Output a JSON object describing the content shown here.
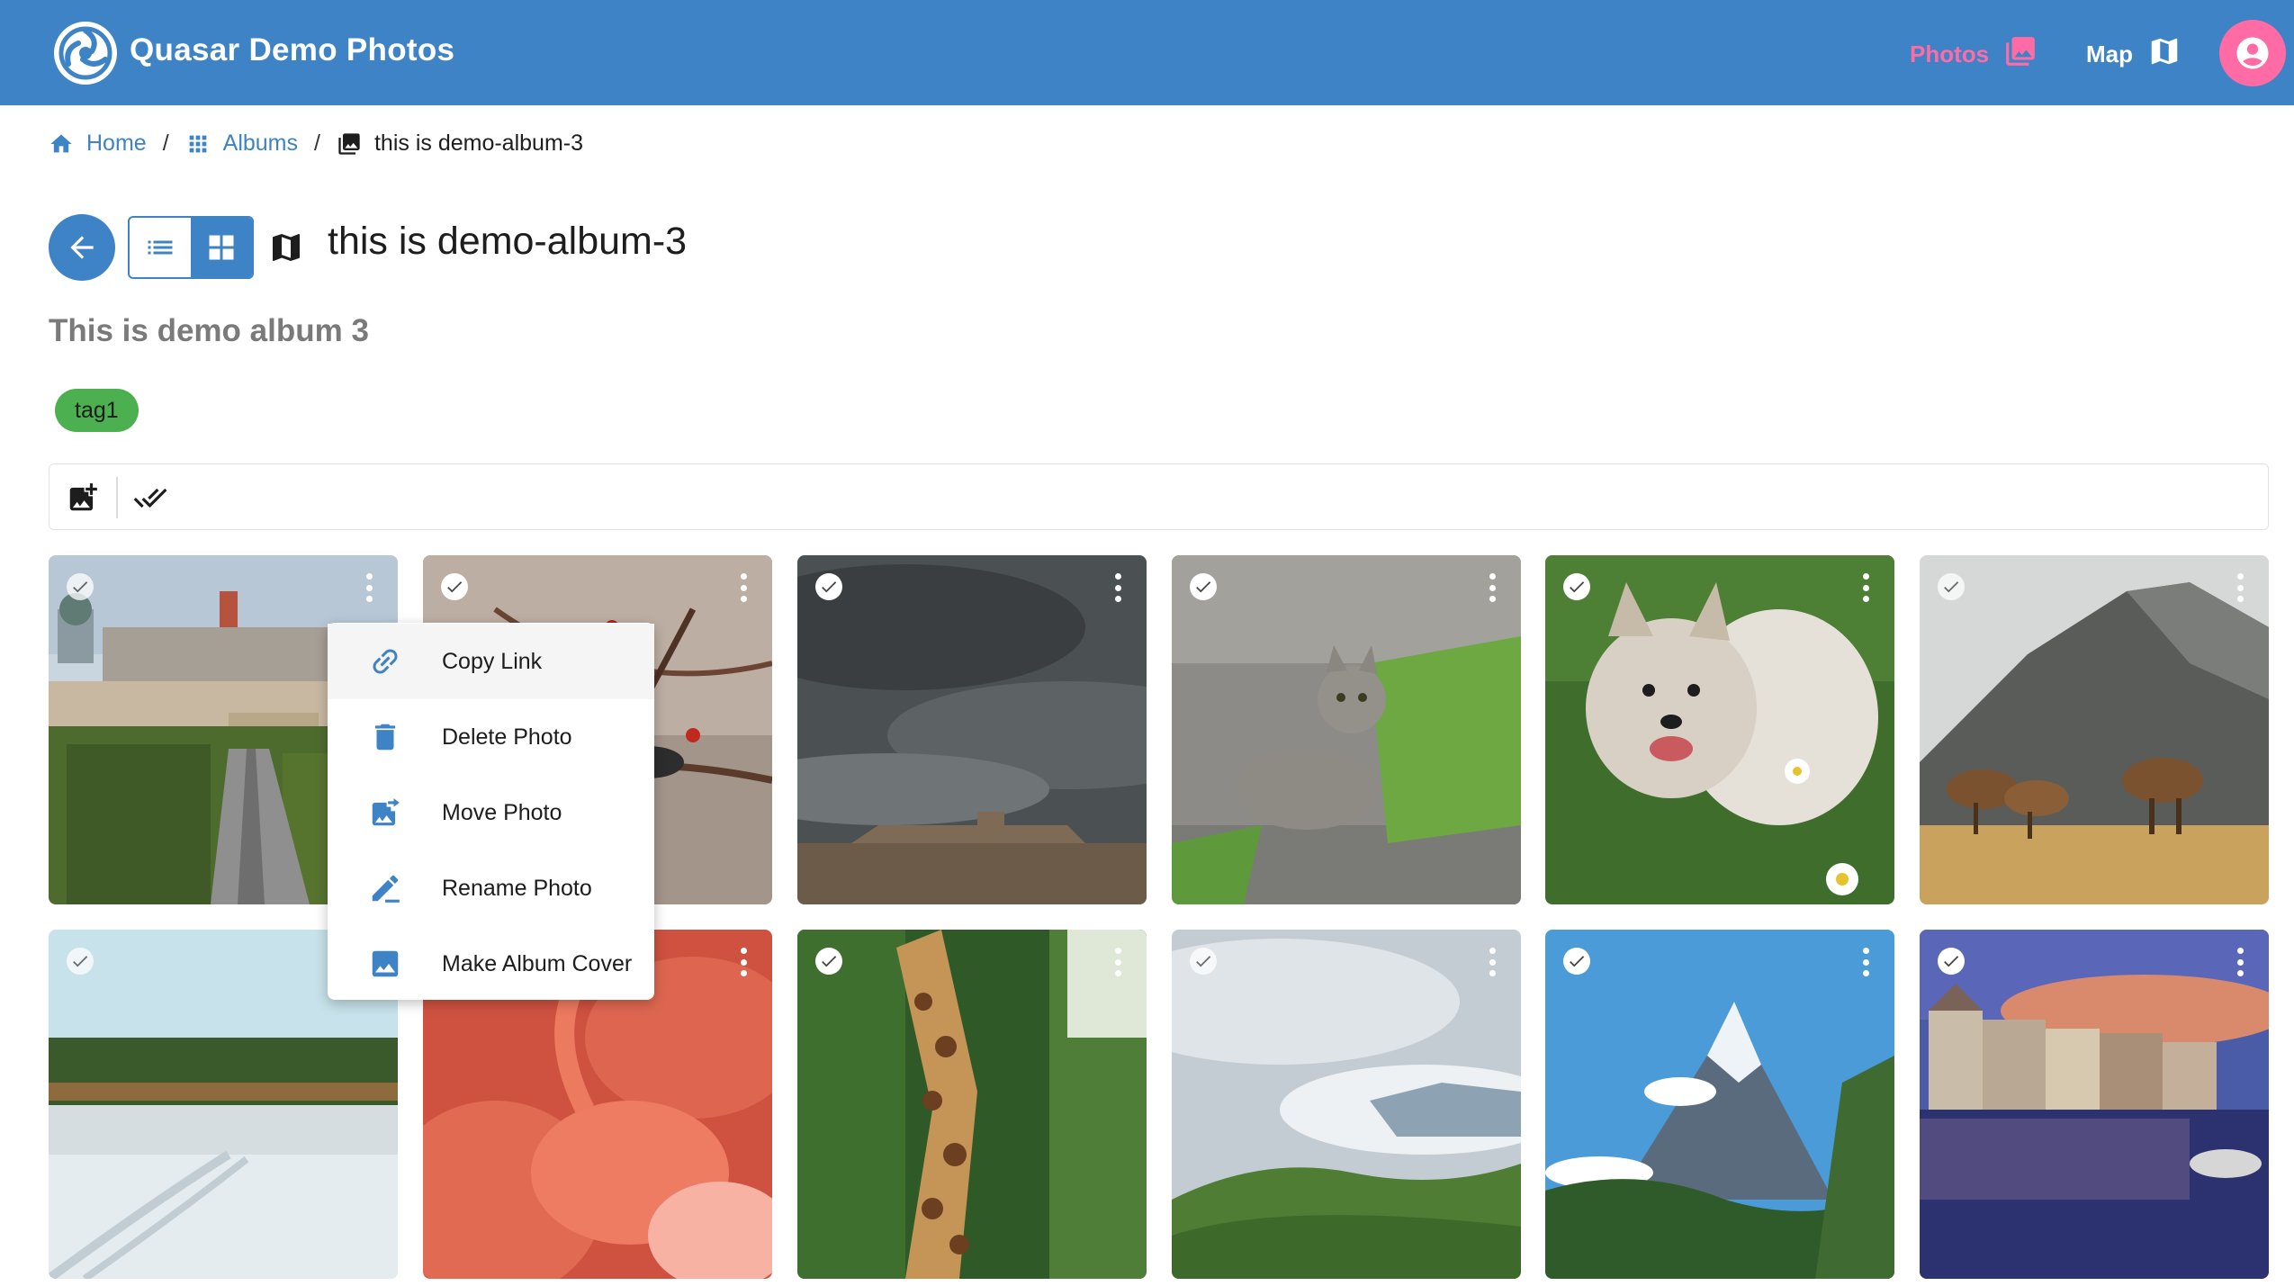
{
  "app": {
    "title": "Quasar Demo Photos"
  },
  "nav": {
    "photos_label": "Photos",
    "map_label": "Map"
  },
  "colors": {
    "primary": "#3e83c6",
    "accent": "#ff6ba5",
    "tag": "#4caf50"
  },
  "breadcrumb": [
    {
      "label": "Home",
      "icon": "home-icon"
    },
    {
      "label": "Albums",
      "icon": "apps-grid-icon"
    },
    {
      "label": "this is demo-album-3",
      "icon": "photo-album-icon"
    }
  ],
  "album": {
    "title": "this is demo-album-3",
    "description": "This is demo album 3",
    "tags": [
      "tag1"
    ],
    "view_mode": "grid"
  },
  "context_menu": {
    "items": [
      {
        "label": "Copy Link",
        "icon": "link-icon"
      },
      {
        "label": "Delete Photo",
        "icon": "trash-icon"
      },
      {
        "label": "Move Photo",
        "icon": "move-photo-icon"
      },
      {
        "label": "Rename Photo",
        "icon": "edit-icon"
      },
      {
        "label": "Make Album Cover",
        "icon": "image-icon"
      }
    ]
  },
  "photos": [
    {
      "subject": "city-skyline-berlin",
      "selected": false
    },
    {
      "subject": "bird-on-branch",
      "selected": false
    },
    {
      "subject": "stormy-sky-castle",
      "selected": false
    },
    {
      "subject": "tabby-cat",
      "selected": false
    },
    {
      "subject": "fluffy-dog-daisies",
      "selected": false
    },
    {
      "subject": "elk-mountain",
      "selected": false
    },
    {
      "subject": "snowy-field-forest",
      "selected": false
    },
    {
      "subject": "flamingos",
      "selected": false
    },
    {
      "subject": "giraffe",
      "selected": false
    },
    {
      "subject": "cloudy-green-hills",
      "selected": false
    },
    {
      "subject": "matterhorn-peak",
      "selected": false
    },
    {
      "subject": "waterfront-town-dusk",
      "selected": false
    }
  ]
}
